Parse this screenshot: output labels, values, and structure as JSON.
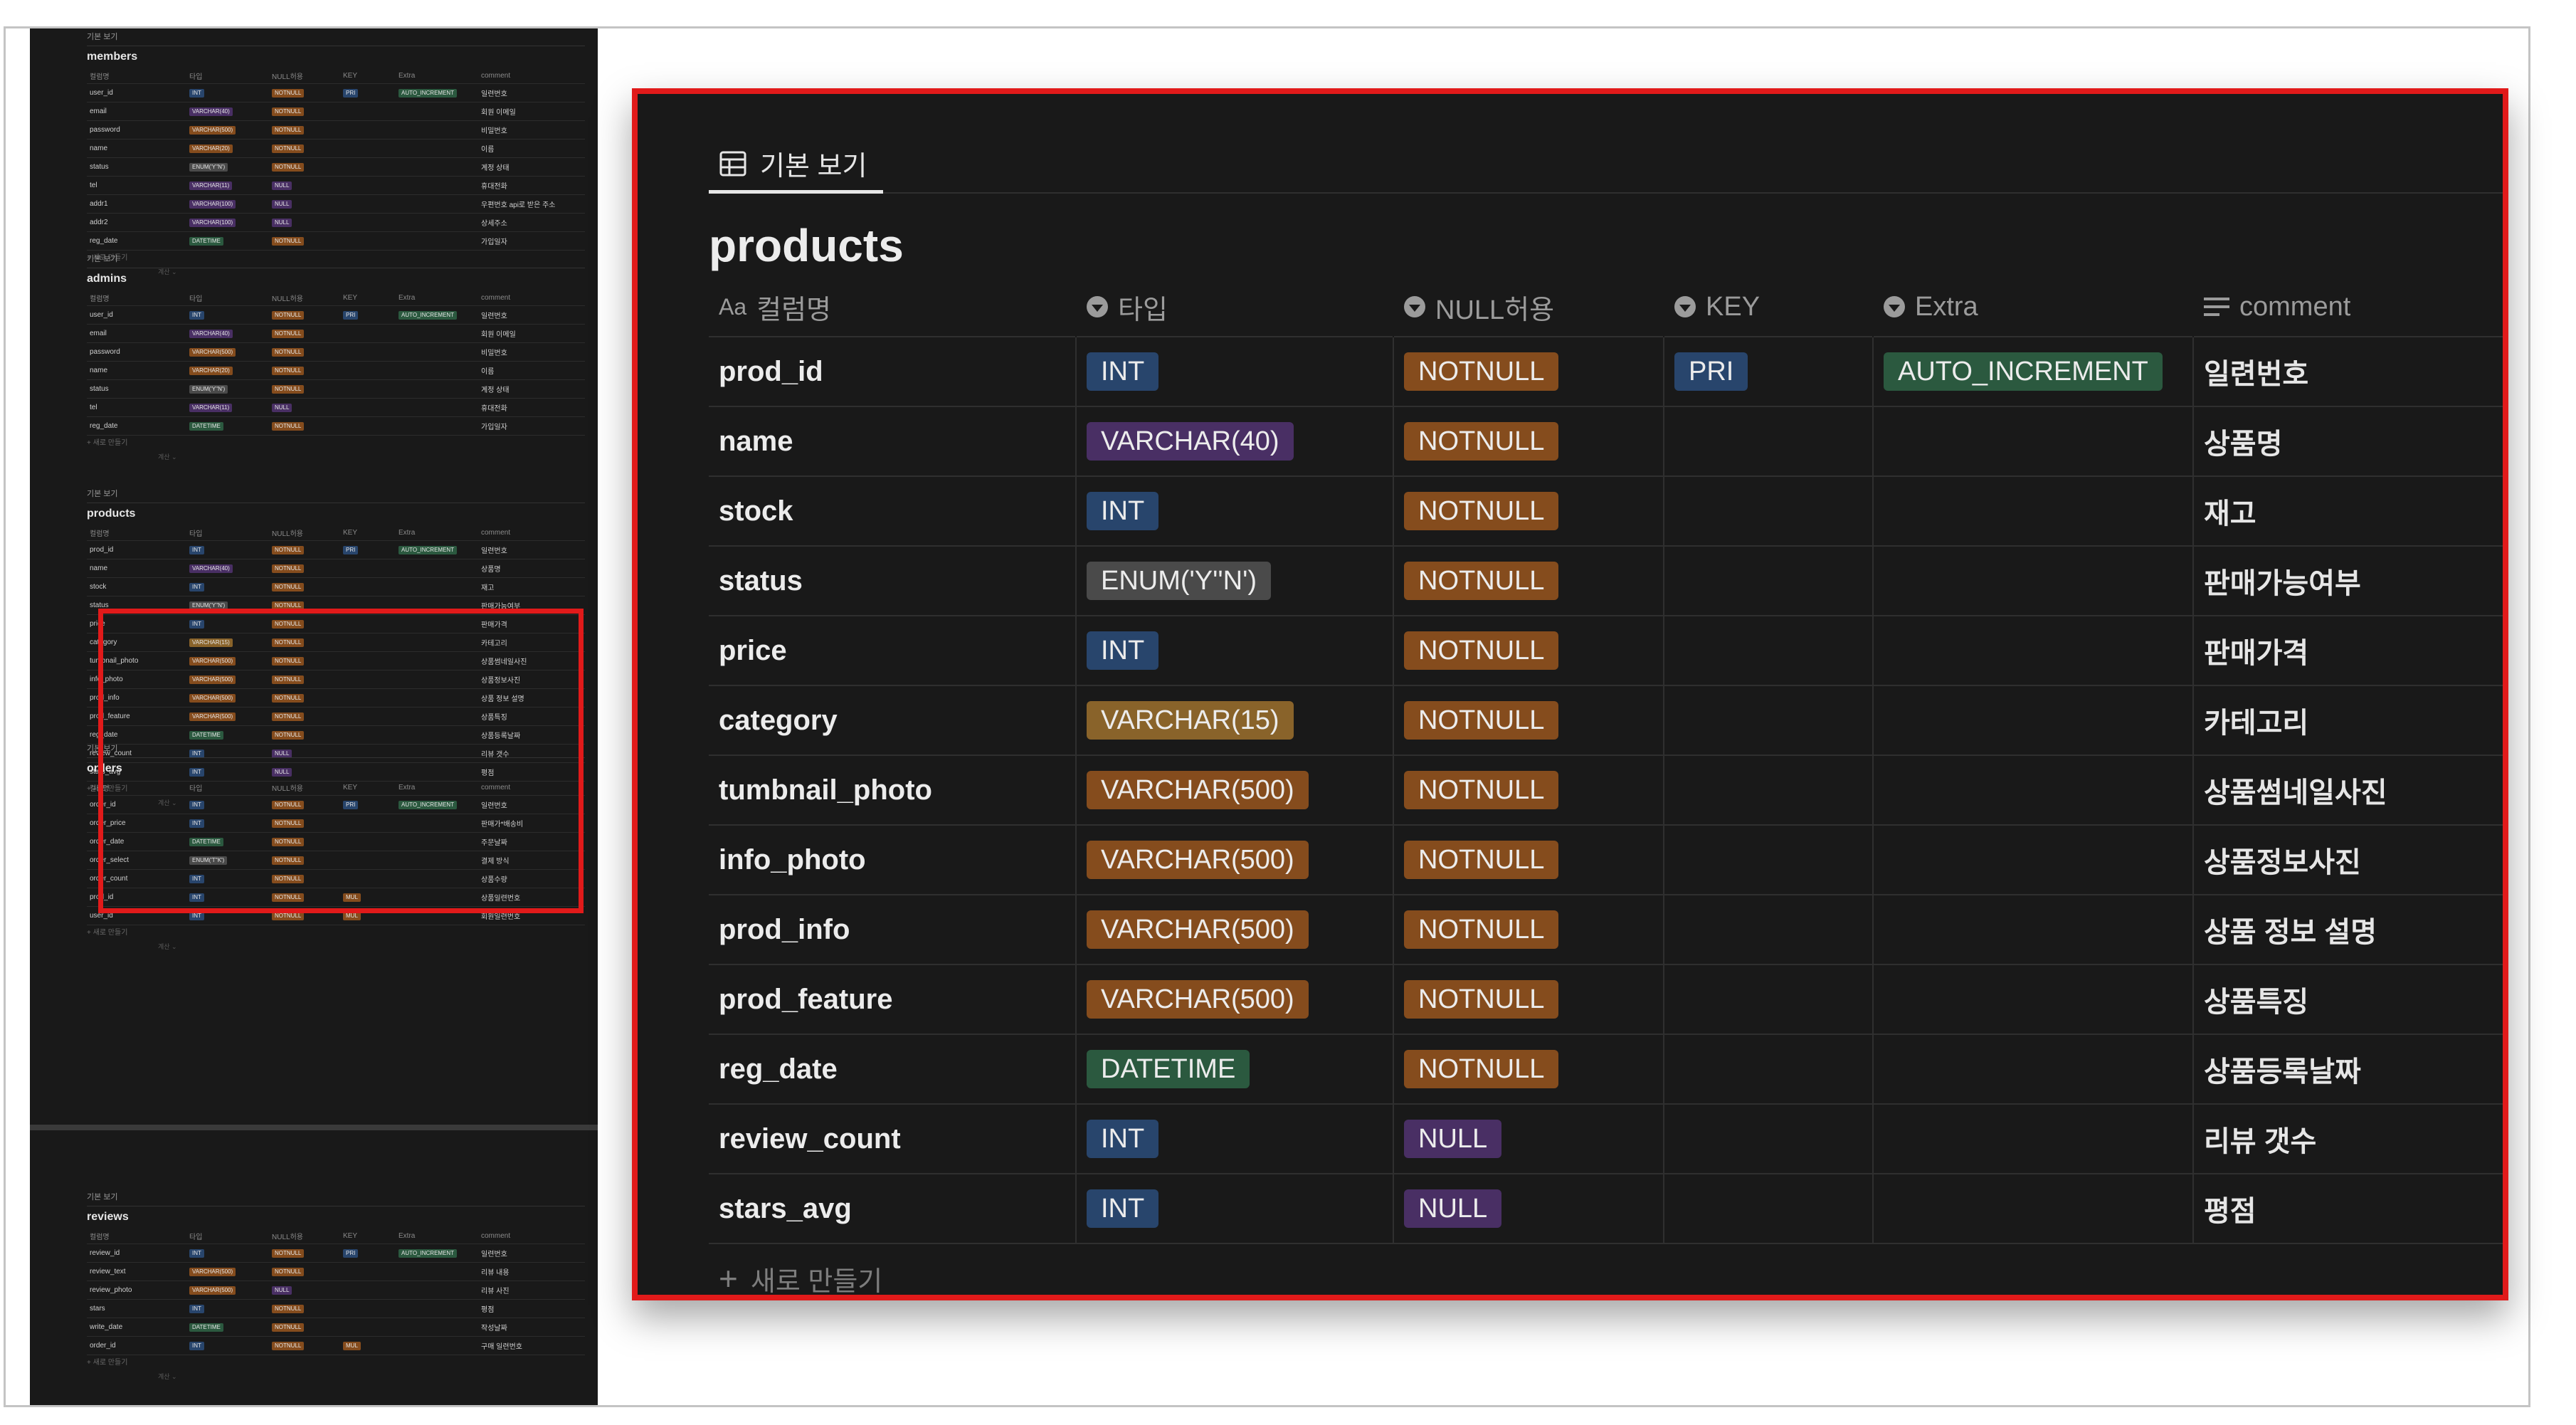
{
  "panel": {
    "view_tab": "기본 보기",
    "db_title": "products",
    "columns": {
      "name": "컬럼명",
      "type": "타입",
      "nullable": "NULL허용",
      "key": "KEY",
      "extra": "Extra",
      "comment": "comment"
    },
    "rows": [
      {
        "name": "prod_id",
        "type": "INT",
        "null": "NOTNULL",
        "key": "PRI",
        "extra": "AUTO_INCREMENT",
        "comment": "일련번호"
      },
      {
        "name": "name",
        "type": "VARCHAR(40)",
        "null": "NOTNULL",
        "key": "",
        "extra": "",
        "comment": "상품명"
      },
      {
        "name": "stock",
        "type": "INT",
        "null": "NOTNULL",
        "key": "",
        "extra": "",
        "comment": "재고"
      },
      {
        "name": "status",
        "type": "ENUM('Y''N')",
        "null": "NOTNULL",
        "key": "",
        "extra": "",
        "comment": "판매가능여부"
      },
      {
        "name": "price",
        "type": "INT",
        "null": "NOTNULL",
        "key": "",
        "extra": "",
        "comment": "판매가격"
      },
      {
        "name": "category",
        "type": "VARCHAR(15)",
        "null": "NOTNULL",
        "key": "",
        "extra": "",
        "comment": "카테고리"
      },
      {
        "name": "tumbnail_photo",
        "type": "VARCHAR(500)",
        "null": "NOTNULL",
        "key": "",
        "extra": "",
        "comment": "상품썸네일사진"
      },
      {
        "name": "info_photo",
        "type": "VARCHAR(500)",
        "null": "NOTNULL",
        "key": "",
        "extra": "",
        "comment": "상품정보사진"
      },
      {
        "name": "prod_info",
        "type": "VARCHAR(500)",
        "null": "NOTNULL",
        "key": "",
        "extra": "",
        "comment": "상품 정보 설명"
      },
      {
        "name": "prod_feature",
        "type": "VARCHAR(500)",
        "null": "NOTNULL",
        "key": "",
        "extra": "",
        "comment": "상품특징"
      },
      {
        "name": "reg_date",
        "type": "DATETIME",
        "null": "NOTNULL",
        "key": "",
        "extra": "",
        "comment": "상품등록날짜"
      },
      {
        "name": "review_count",
        "type": "INT",
        "null": "NULL",
        "key": "",
        "extra": "",
        "comment": "리뷰 갯수"
      },
      {
        "name": "stars_avg",
        "type": "INT",
        "null": "NULL",
        "key": "",
        "extra": "",
        "comment": "평점"
      }
    ],
    "new_label": "새로 만들기"
  },
  "thumbnail": {
    "view_label": "기본 보기",
    "new_label": "+ 새로 만들기",
    "calc_label": "계산 ⌄",
    "headers": [
      "컬럼명",
      "타입",
      "NULL허용",
      "KEY",
      "Extra",
      "comment"
    ],
    "tables": [
      {
        "title": "members",
        "rows": [
          [
            "user_id",
            "INT",
            "NOTNULL",
            "PRI",
            "AUTO_INCREMENT",
            "일련번호"
          ],
          [
            "email",
            "VARCHAR(40)",
            "NOTNULL",
            "",
            "",
            "회원 이메일"
          ],
          [
            "password",
            "VARCHAR(500)",
            "NOTNULL",
            "",
            "",
            "비밀번호"
          ],
          [
            "name",
            "VARCHAR(20)",
            "NOTNULL",
            "",
            "",
            "이름"
          ],
          [
            "status",
            "ENUM('Y''N')",
            "NOTNULL",
            "",
            "",
            "계정 상태"
          ],
          [
            "tel",
            "VARCHAR(11)",
            "NULL",
            "",
            "",
            "휴대전화"
          ],
          [
            "addr1",
            "VARCHAR(100)",
            "NULL",
            "",
            "",
            "우편번호 api로 받은 주소"
          ],
          [
            "addr2",
            "VARCHAR(100)",
            "NULL",
            "",
            "",
            "상세주소"
          ],
          [
            "reg_date",
            "DATETIME",
            "NOTNULL",
            "",
            "",
            "가입일자"
          ]
        ]
      },
      {
        "title": "admins",
        "rows": [
          [
            "user_id",
            "INT",
            "NOTNULL",
            "PRI",
            "AUTO_INCREMENT",
            "일련번호"
          ],
          [
            "email",
            "VARCHAR(40)",
            "NOTNULL",
            "",
            "",
            "회원 이메일"
          ],
          [
            "password",
            "VARCHAR(500)",
            "NOTNULL",
            "",
            "",
            "비밀번호"
          ],
          [
            "name",
            "VARCHAR(20)",
            "NOTNULL",
            "",
            "",
            "이름"
          ],
          [
            "status",
            "ENUM('Y''N')",
            "NOTNULL",
            "",
            "",
            "계정 상태"
          ],
          [
            "tel",
            "VARCHAR(11)",
            "NULL",
            "",
            "",
            "휴대전화"
          ],
          [
            "reg_date",
            "DATETIME",
            "NOTNULL",
            "",
            "",
            "가입일자"
          ]
        ]
      },
      {
        "title": "products",
        "rows": [
          [
            "prod_id",
            "INT",
            "NOTNULL",
            "PRI",
            "AUTO_INCREMENT",
            "일련번호"
          ],
          [
            "name",
            "VARCHAR(40)",
            "NOTNULL",
            "",
            "",
            "상품명"
          ],
          [
            "stock",
            "INT",
            "NOTNULL",
            "",
            "",
            "재고"
          ],
          [
            "status",
            "ENUM('Y''N')",
            "NOTNULL",
            "",
            "",
            "판매가능여부"
          ],
          [
            "price",
            "INT",
            "NOTNULL",
            "",
            "",
            "판매가격"
          ],
          [
            "category",
            "VARCHAR(15)",
            "NOTNULL",
            "",
            "",
            "카테고리"
          ],
          [
            "tumbnail_photo",
            "VARCHAR(500)",
            "NOTNULL",
            "",
            "",
            "상품썸네일사진"
          ],
          [
            "info_photo",
            "VARCHAR(500)",
            "NOTNULL",
            "",
            "",
            "상품정보사진"
          ],
          [
            "prod_info",
            "VARCHAR(500)",
            "NOTNULL",
            "",
            "",
            "상품 정보 설명"
          ],
          [
            "prod_feature",
            "VARCHAR(500)",
            "NOTNULL",
            "",
            "",
            "상품특징"
          ],
          [
            "reg_date",
            "DATETIME",
            "NOTNULL",
            "",
            "",
            "상품등록날짜"
          ],
          [
            "review_count",
            "INT",
            "NULL",
            "",
            "",
            "리뷰 갯수"
          ],
          [
            "stars_avg",
            "INT",
            "NULL",
            "",
            "",
            "평점"
          ]
        ]
      },
      {
        "title": "orders",
        "rows": [
          [
            "order_id",
            "INT",
            "NOTNULL",
            "PRI",
            "AUTO_INCREMENT",
            "일련번호"
          ],
          [
            "order_price",
            "INT",
            "NOTNULL",
            "",
            "",
            "판매가*배송비"
          ],
          [
            "order_date",
            "DATETIME",
            "NOTNULL",
            "",
            "",
            "주문날짜"
          ],
          [
            "order_select",
            "ENUM('T''K')",
            "NOTNULL",
            "",
            "",
            "결제 방식"
          ],
          [
            "order_count",
            "INT",
            "NOTNULL",
            "",
            "",
            "상품수량"
          ],
          [
            "prod_id",
            "INT",
            "NOTNULL",
            "MUL",
            "",
            "상품일련번호"
          ],
          [
            "user_id",
            "INT",
            "NOTNULL",
            "MUL",
            "",
            "회원일련번호"
          ]
        ]
      },
      {
        "title": "reviews",
        "rows": [
          [
            "review_id",
            "INT",
            "NOTNULL",
            "PRI",
            "AUTO_INCREMENT",
            "일련번호"
          ],
          [
            "review_text",
            "VARCHAR(500)",
            "NOTNULL",
            "",
            "",
            "리뷰 내용"
          ],
          [
            "review_photo",
            "VARCHAR(500)",
            "NULL",
            "",
            "",
            "리뷰 사진"
          ],
          [
            "stars",
            "INT",
            "NOTNULL",
            "",
            "",
            "평점"
          ],
          [
            "write_date",
            "DATETIME",
            "NOTNULL",
            "",
            "",
            "작성날짜"
          ],
          [
            "order_id",
            "INT",
            "NOTNULL",
            "MUL",
            "",
            "구매 일련번호"
          ]
        ]
      }
    ]
  },
  "colors": {
    "highlight": "#e11a1a",
    "dark_bg": "#191919",
    "pill_int": "#28456c",
    "pill_purple": "#492f64",
    "pill_orange": "#854c1d",
    "pill_amber": "#89632a",
    "pill_green": "#2b593f",
    "pill_gray": "#4a4a4a"
  }
}
